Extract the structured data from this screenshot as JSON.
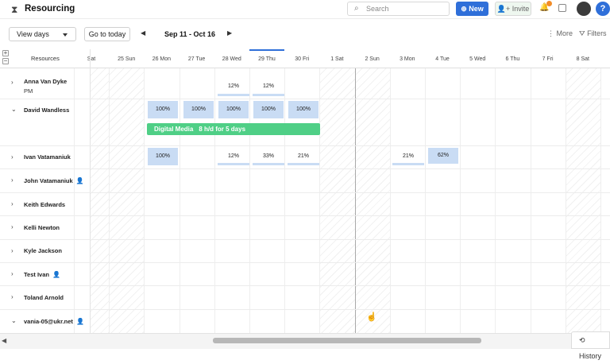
{
  "app": {
    "title": "Resourcing"
  },
  "top": {
    "search_placeholder": "Search",
    "new_label": "New",
    "invite_label": "Invite",
    "help_label": "?"
  },
  "toolbar": {
    "view_label": "View days",
    "today_label": "Go to today",
    "range": "Sep 11 - Oct 16",
    "more_label": "More",
    "filters_label": "Filters"
  },
  "grid": {
    "resources_label": "Resources",
    "days": [
      "Sat",
      "25 Sun",
      "26 Mon",
      "27 Tue",
      "28 Wed",
      "29 Thu",
      "30 Fri",
      "1 Sat",
      "2 Sun",
      "3 Mon",
      "4 Tue",
      "5 Wed",
      "6 Thu",
      "7 Fri",
      "8 Sat"
    ],
    "today_index": 5
  },
  "rows": [
    {
      "name": "Anna Van Dyke",
      "sub": "PM",
      "expanded": false,
      "icon": ""
    },
    {
      "name": "David Wandless",
      "expanded": true,
      "icon": ""
    },
    {
      "name": "Ivan Vatamaniuk",
      "expanded": false,
      "icon": ""
    },
    {
      "name": "John Vatamaniuk",
      "expanded": false,
      "icon": "user-icon"
    },
    {
      "name": "Keith Edwards",
      "expanded": false,
      "icon": ""
    },
    {
      "name": "Kelli Newton",
      "expanded": false,
      "icon": ""
    },
    {
      "name": "Kyle Jackson",
      "expanded": false,
      "icon": ""
    },
    {
      "name": "Test Ivan",
      "expanded": false,
      "icon": "user-icon"
    },
    {
      "name": "Toland Arnold",
      "expanded": false,
      "icon": ""
    },
    {
      "name": "vania-05@ukr.net",
      "expanded": true,
      "icon": "user-icon"
    }
  ],
  "allocations": {
    "anna": [
      "12%",
      "12%"
    ],
    "david": [
      "100%",
      "100%",
      "100%",
      "100%",
      "100%"
    ],
    "ivan": [
      "100%",
      "12%",
      "33%",
      "21%",
      "21%",
      "62%"
    ]
  },
  "project": {
    "name": "Digital Media",
    "hours": "8 h/d for 5 days",
    "color": "#4fcf86"
  },
  "footer": {
    "history_label": "History"
  }
}
